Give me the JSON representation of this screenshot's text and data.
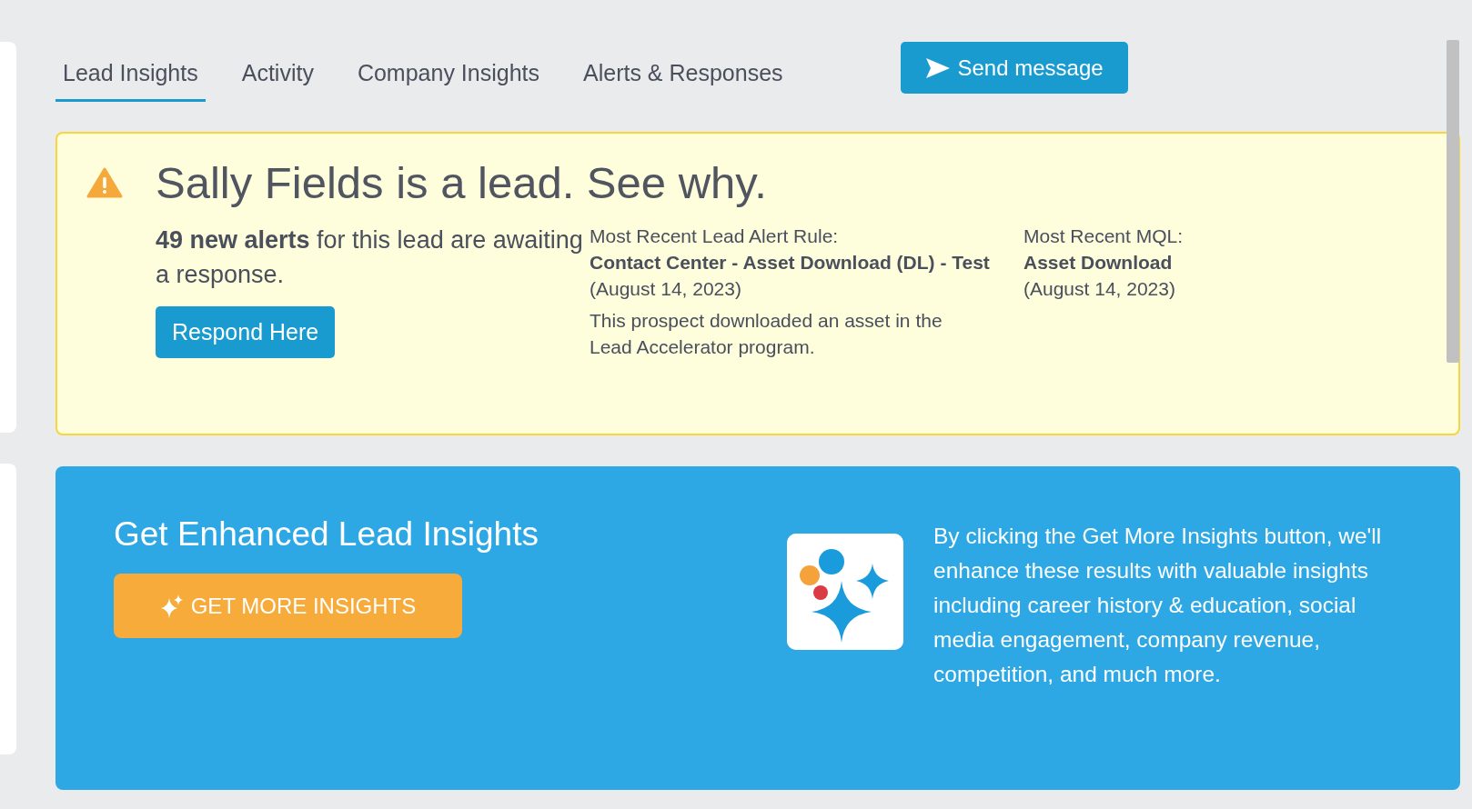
{
  "tabs": [
    {
      "label": "Lead Insights",
      "selected": true
    },
    {
      "label": "Activity",
      "selected": false
    },
    {
      "label": "Company Insights",
      "selected": false
    },
    {
      "label": "Alerts & Responses",
      "selected": false
    }
  ],
  "send_button": "Send message",
  "alert": {
    "title": "Sally Fields is a lead. See why.",
    "summary": "**49 new alerts** for this lead are awaiting a response.",
    "respond_button": "Respond Here",
    "rule": {
      "label": "Most Recent Lead Alert Rule:",
      "name": "Contact Center - Asset Download (DL) - Test",
      "date": "(August 14, 2023)",
      "description": "This prospect downloaded an asset in the Lead Accelerator program."
    },
    "mql": {
      "label": "Most Recent MQL:",
      "name": "Asset Download",
      "date": "(August 14, 2023)"
    }
  },
  "insights": {
    "title": "Get Enhanced Lead Insights",
    "button": "GET MORE INSIGHTS",
    "description": "By clicking the Get More Insights button, we'll enhance these results with valuable insights including career history & education, social media engagement, company revenue, competition, and much more."
  }
}
